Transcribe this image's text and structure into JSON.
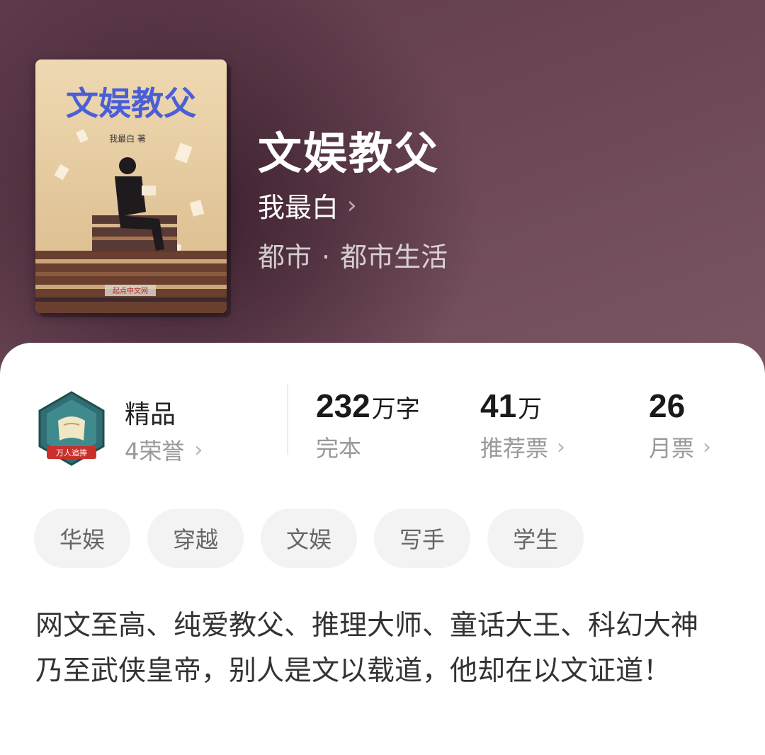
{
  "book": {
    "title": "文娱教父",
    "author": "我最白",
    "genre_main": "都市",
    "genre_separator": "·",
    "genre_sub": "都市生活",
    "cover": {
      "title_text": "文娱教父",
      "author_text": "我最白 著",
      "publisher_text": "起点中文网"
    }
  },
  "quality": {
    "label": "精品",
    "honors": "4荣誉",
    "badge_text": "万人追捧"
  },
  "stats": {
    "words_value": "232",
    "words_unit": "万字",
    "words_label": "完本",
    "recommend_value": "41",
    "recommend_unit": "万",
    "recommend_label": "推荐票",
    "monthly_value": "26",
    "monthly_label": "月票"
  },
  "tags": [
    "华娱",
    "穿越",
    "文娱",
    "写手",
    "学生"
  ],
  "description": "网文至高、纯爱教父、推理大师、童话大王、科幻大神乃至武侠皇帝，别人是文以载道，他却在以文证道！",
  "colors": {
    "hero_bg": "#6c4656",
    "tag_bg": "#f3f3f3",
    "muted_text": "#999999"
  }
}
